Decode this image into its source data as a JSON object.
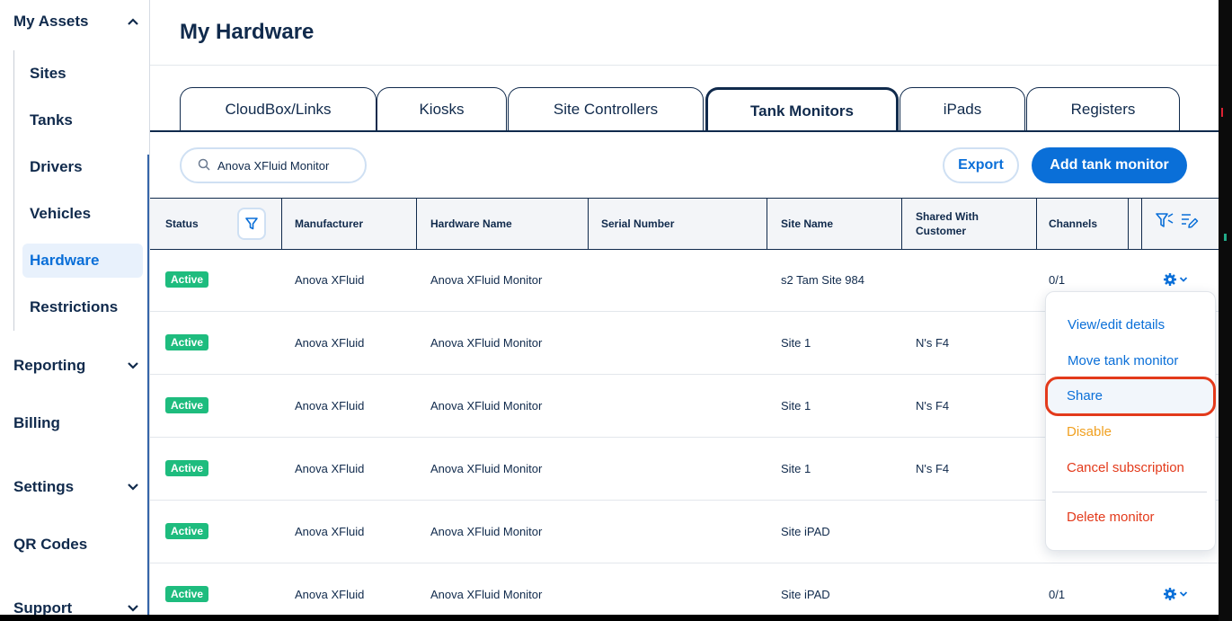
{
  "sidebar": {
    "my_assets": "My Assets",
    "items": [
      "Sites",
      "Tanks",
      "Drivers",
      "Vehicles",
      "Hardware",
      "Restrictions"
    ],
    "active_item": "Hardware",
    "reporting": "Reporting",
    "billing": "Billing",
    "settings": "Settings",
    "qr_codes": "QR Codes",
    "support": "Support"
  },
  "page": {
    "title": "My Hardware"
  },
  "tabs": [
    "CloudBox/Links",
    "Kiosks",
    "Site Controllers",
    "Tank Monitors",
    "iPads",
    "Registers"
  ],
  "active_tab": "Tank Monitors",
  "search": {
    "value": "Anova XFluid Monitor"
  },
  "toolbar": {
    "export_label": "Export",
    "add_label": "Add tank monitor"
  },
  "table": {
    "headers": {
      "status": "Status",
      "manufacturer": "Manufacturer",
      "hardware_name": "Hardware Name",
      "serial_number": "Serial Number",
      "site_name": "Site Name",
      "shared_line1": "Shared With",
      "shared_line2": "Customer",
      "channels": "Channels"
    },
    "rows": [
      {
        "status": "Active",
        "manufacturer": "Anova XFluid",
        "hardware_name": "Anova XFluid Monitor",
        "serial": "",
        "site": "s2 Tam Site 984",
        "shared": "",
        "channels": "0/1"
      },
      {
        "status": "Active",
        "manufacturer": "Anova XFluid",
        "hardware_name": "Anova XFluid Monitor",
        "serial": "",
        "site": "Site 1",
        "shared": "N's F4",
        "channels": ""
      },
      {
        "status": "Active",
        "manufacturer": "Anova XFluid",
        "hardware_name": "Anova XFluid Monitor",
        "serial": "",
        "site": "Site 1",
        "shared": "N's F4",
        "channels": ""
      },
      {
        "status": "Active",
        "manufacturer": "Anova XFluid",
        "hardware_name": "Anova XFluid Monitor",
        "serial": "",
        "site": "Site 1",
        "shared": "N's F4",
        "channels": ""
      },
      {
        "status": "Active",
        "manufacturer": "Anova XFluid",
        "hardware_name": "Anova XFluid Monitor",
        "serial": "",
        "site": "Site iPAD",
        "shared": "",
        "channels": ""
      },
      {
        "status": "Active",
        "manufacturer": "Anova XFluid",
        "hardware_name": "Anova XFluid Monitor",
        "serial": "",
        "site": "Site iPAD",
        "shared": "",
        "channels": "0/1"
      }
    ]
  },
  "menu": {
    "view_edit": "View/edit details",
    "move": "Move tank monitor",
    "share": "Share",
    "disable": "Disable",
    "cancel": "Cancel subscription",
    "delete": "Delete monitor"
  },
  "colors": {
    "navy": "#102a4c",
    "accent": "#0a6fd8",
    "active_badge": "#1ebc7e",
    "disable": "#f0a020",
    "danger": "#e33a1b"
  }
}
